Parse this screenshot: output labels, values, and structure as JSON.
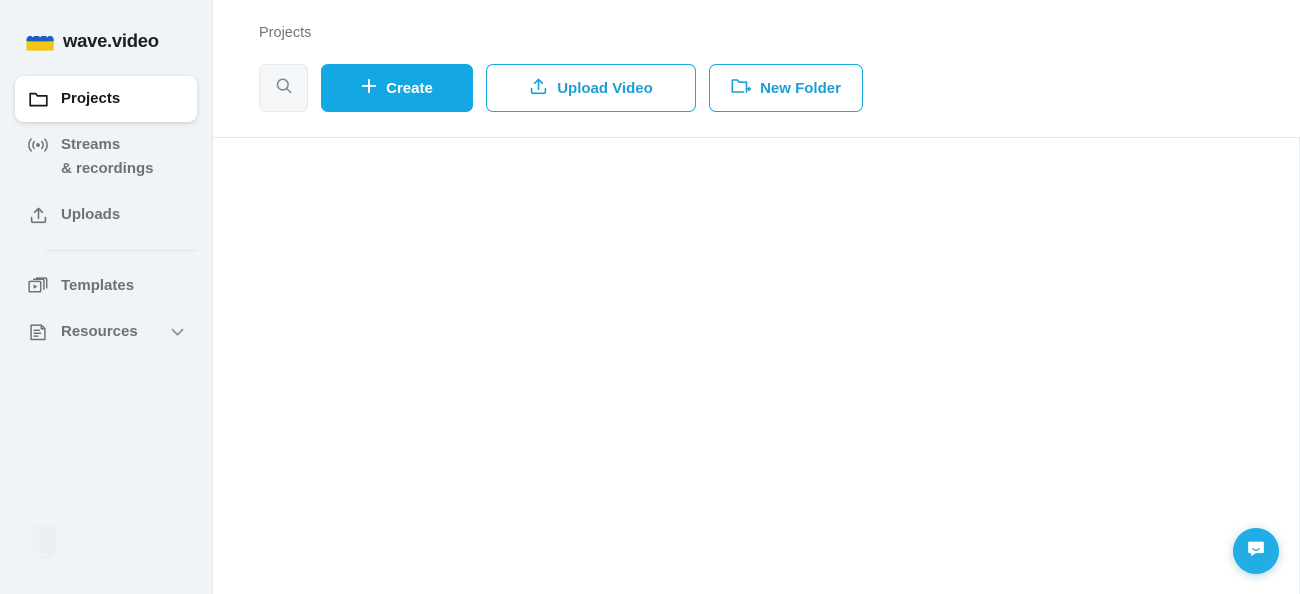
{
  "brand": {
    "name": "wave.video",
    "logo_icon": "wave-w-logo-icon",
    "logo_colors": {
      "top": "#1a5fc4",
      "bottom": "#f4c412"
    }
  },
  "sidebar": {
    "background": "#f1f4f6",
    "items": [
      {
        "id": "projects",
        "label": "Projects",
        "icon": "folder-icon",
        "active": true,
        "expandable": false
      },
      {
        "id": "streams",
        "label": "Streams\n& recordings",
        "icon": "broadcast-icon",
        "active": false,
        "expandable": false
      },
      {
        "id": "uploads",
        "label": "Uploads",
        "icon": "upload-icon",
        "active": false,
        "expandable": false
      },
      {
        "id": "templates",
        "label": "Templates",
        "icon": "templates-icon",
        "active": false,
        "expandable": false
      },
      {
        "id": "resources",
        "label": "Resources",
        "icon": "document-icon",
        "active": false,
        "expandable": true,
        "chevron": "chevron-down-icon"
      }
    ]
  },
  "header": {
    "breadcrumb": "Projects"
  },
  "toolbar": {
    "search": {
      "label": "",
      "icon": "search-icon"
    },
    "create": {
      "label": "Create",
      "icon": "plus-icon",
      "accent": "#13a7e3"
    },
    "upload": {
      "label": "Upload Video",
      "icon": "upload-icon",
      "accent": "#1c9fd4"
    },
    "folder": {
      "label": "New Folder",
      "icon": "new-folder-icon",
      "accent": "#1c9fd4"
    }
  },
  "content": {
    "empty": ""
  },
  "chat": {
    "icon": "chat-smile-icon",
    "color": "#22aee4"
  }
}
